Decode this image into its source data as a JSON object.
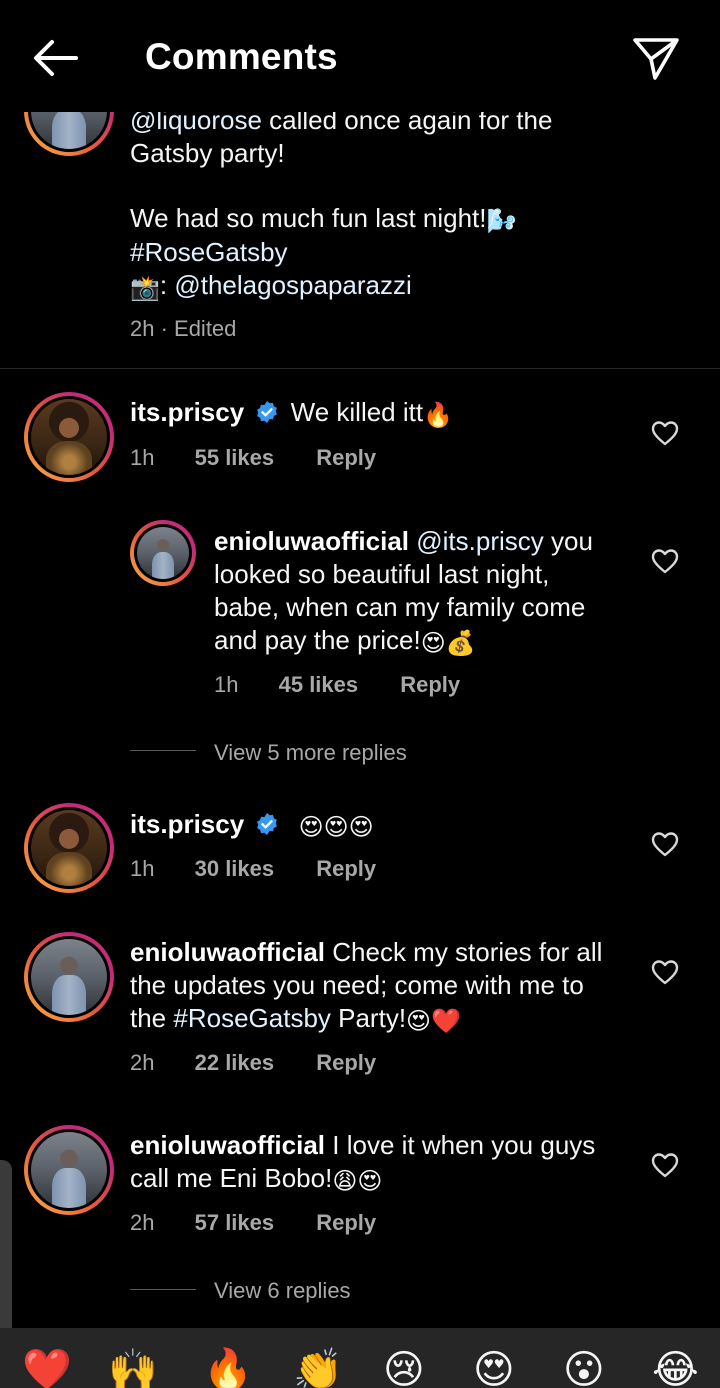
{
  "header": {
    "title": "Comments"
  },
  "caption": {
    "line1_mention": "@liquorose",
    "line1_rest": " called once again for the",
    "line2": "Gatsby party!",
    "line3": "We had so much fun last night!",
    "line3_emoji": "🌬️",
    "hashtag": "#RoseGatsby",
    "camera_emoji": "📸",
    "credit_prefix": ": ",
    "credit_mention": "@thelagospaparazzi",
    "meta": "2h · Edited"
  },
  "comments": [
    {
      "user": "its.priscy",
      "text": "We killed itt",
      "emoji": "🔥",
      "time": "1h",
      "likes": "55 likes",
      "reply": "Reply"
    },
    {
      "user": "enioluwaofficial",
      "mention": "@its.priscy",
      "line1_rest": " you",
      "line2": "looked so beautiful last night,",
      "line3": "babe, when can my family come",
      "line4": "and pay the price!",
      "emoji": "😍💰",
      "time": "1h",
      "likes": "45 likes",
      "reply": "Reply",
      "view_more": "View 5 more replies"
    },
    {
      "user": "its.priscy",
      "emoji": "😍😍😍",
      "time": "1h",
      "likes": "30 likes",
      "reply": "Reply"
    },
    {
      "user": "enioluwaofficial",
      "line1": " Check my stories for all",
      "line2": "the updates you need; come with me to",
      "line3_pre": "the ",
      "hashtag": "#RoseGatsby",
      "line3_post": " Party!",
      "emoji": "😍❤️",
      "time": "2h",
      "likes": "22 likes",
      "reply": "Reply"
    },
    {
      "user": "enioluwaofficial",
      "line1": " I love it when you guys",
      "line2": "call me Eni Bobo!",
      "emoji": "😩😍",
      "time": "2h",
      "likes": "57 likes",
      "reply": "Reply",
      "view_more": "View 6 replies"
    }
  ],
  "emoji_bar": [
    "❤️",
    "🙌",
    "🔥",
    "👏",
    "😢",
    "😍",
    "😮",
    "😂"
  ],
  "colors": {
    "background": "#000000",
    "text": "#f5f5f5",
    "muted": "#a8a8a8",
    "verified": "#3897f0",
    "link": "#e0f1ff"
  }
}
